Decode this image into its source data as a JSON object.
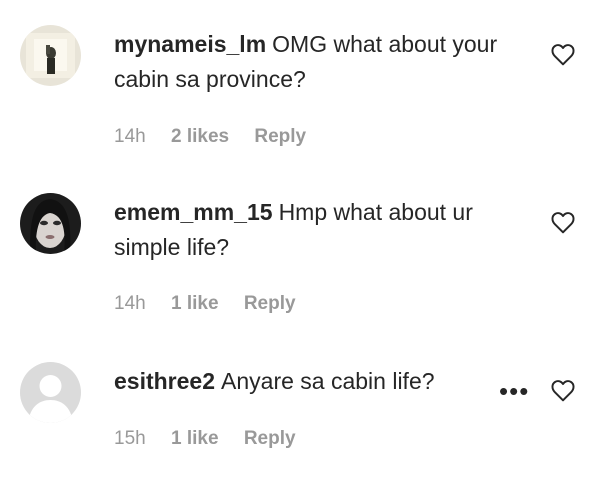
{
  "comments": [
    {
      "username": "mynameis_lm",
      "text": "OMG what about your cabin sa province?",
      "time": "14h",
      "likes": "2 likes",
      "reply": "Reply",
      "avatar_icon": "profile-photo-icon"
    },
    {
      "username": "emem_mm_15",
      "text": "Hmp what about ur simple life?",
      "time": "14h",
      "likes": "1 like",
      "reply": "Reply",
      "avatar_icon": "profile-photo-icon"
    },
    {
      "username": "esithree2",
      "text": "Anyare sa cabin life?",
      "time": "15h",
      "likes": "1 like",
      "reply": "Reply",
      "avatar_icon": "default-avatar-icon",
      "more_options": "•••"
    }
  ],
  "icons": {
    "like": "heart-outline-icon",
    "options": "more-options-icon"
  },
  "colors": {
    "text": "#262626",
    "meta": "#999999",
    "placeholder_avatar": "#dbdbdb"
  }
}
